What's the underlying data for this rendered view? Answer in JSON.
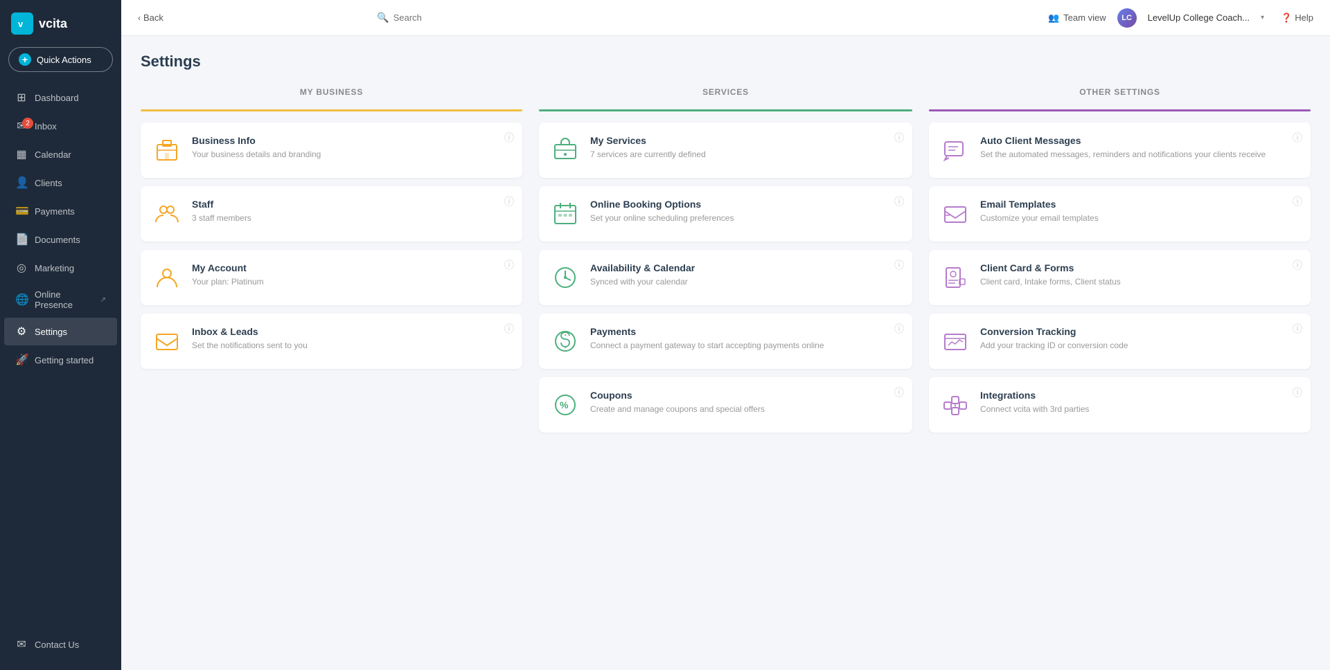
{
  "logo": {
    "text": "vcita",
    "icon": "v"
  },
  "quick_actions": {
    "label": "Quick Actions"
  },
  "nav": {
    "items": [
      {
        "id": "dashboard",
        "label": "Dashboard",
        "icon": "⊞",
        "active": false,
        "badge": null
      },
      {
        "id": "inbox",
        "label": "Inbox",
        "icon": "✉",
        "active": false,
        "badge": "2"
      },
      {
        "id": "calendar",
        "label": "Calendar",
        "icon": "📆",
        "active": false,
        "badge": null
      },
      {
        "id": "clients",
        "label": "Clients",
        "icon": "👤",
        "active": false,
        "badge": null
      },
      {
        "id": "payments",
        "label": "Payments",
        "icon": "💳",
        "active": false,
        "badge": null
      },
      {
        "id": "documents",
        "label": "Documents",
        "icon": "📄",
        "active": false,
        "badge": null
      },
      {
        "id": "marketing",
        "label": "Marketing",
        "icon": "📢",
        "active": false,
        "badge": null
      },
      {
        "id": "online-presence",
        "label": "Online Presence",
        "icon": "🌐",
        "active": false,
        "badge": null,
        "external": true
      },
      {
        "id": "settings",
        "label": "Settings",
        "icon": "⚙",
        "active": true,
        "badge": null
      },
      {
        "id": "getting-started",
        "label": "Getting started",
        "icon": "🚀",
        "active": false,
        "badge": null
      },
      {
        "id": "contact-us",
        "label": "Contact Us",
        "icon": "📞",
        "active": false,
        "badge": null
      }
    ]
  },
  "topbar": {
    "back_label": "Back",
    "search_placeholder": "Search",
    "team_view_label": "Team view",
    "user_name": "LevelUp College Coach...",
    "user_initials": "LC",
    "help_label": "Help"
  },
  "page": {
    "title": "Settings",
    "columns": [
      {
        "id": "my-business",
        "header": "MY BUSINESS",
        "divider_color": "divider-yellow",
        "cards": [
          {
            "id": "business-info",
            "title": "Business Info",
            "subtitle": "Your business details and branding",
            "icon_type": "building",
            "icon_color": "yellow"
          },
          {
            "id": "staff",
            "title": "Staff",
            "subtitle": "3 staff members",
            "icon_type": "users",
            "icon_color": "yellow"
          },
          {
            "id": "my-account",
            "title": "My Account",
            "subtitle": "Your plan: Platinum",
            "icon_type": "account",
            "icon_color": "yellow"
          },
          {
            "id": "inbox-leads",
            "title": "Inbox & Leads",
            "subtitle": "Set the notifications sent to you",
            "icon_type": "inbox",
            "icon_color": "yellow"
          }
        ]
      },
      {
        "id": "services",
        "header": "SERVICES",
        "divider_color": "divider-green",
        "cards": [
          {
            "id": "my-services",
            "title": "My Services",
            "subtitle": "7 services are currently defined",
            "icon_type": "briefcase",
            "icon_color": "green"
          },
          {
            "id": "online-booking",
            "title": "Online Booking Options",
            "subtitle": "Set your online scheduling preferences",
            "icon_type": "calendar",
            "icon_color": "green"
          },
          {
            "id": "availability",
            "title": "Availability & Calendar",
            "subtitle": "Synced with your calendar",
            "icon_type": "clock",
            "icon_color": "green"
          },
          {
            "id": "payments-settings",
            "title": "Payments",
            "subtitle": "Connect a payment gateway to start accepting payments online",
            "icon_type": "payment",
            "icon_color": "green"
          },
          {
            "id": "coupons",
            "title": "Coupons",
            "subtitle": "Create and manage coupons and special offers",
            "icon_type": "coupon",
            "icon_color": "green"
          }
        ]
      },
      {
        "id": "other-settings",
        "header": "OTHER SETTINGS",
        "divider_color": "divider-purple",
        "cards": [
          {
            "id": "auto-client-messages",
            "title": "Auto Client Messages",
            "subtitle": "Set the automated messages, reminders and notifications your clients receive",
            "icon_type": "message",
            "icon_color": "purple"
          },
          {
            "id": "email-templates",
            "title": "Email Templates",
            "subtitle": "Customize your email templates",
            "icon_type": "email",
            "icon_color": "purple"
          },
          {
            "id": "client-card-forms",
            "title": "Client Card & Forms",
            "subtitle": "Client card, Intake forms, Client status",
            "icon_type": "form",
            "icon_color": "purple"
          },
          {
            "id": "conversion-tracking",
            "title": "Conversion Tracking",
            "subtitle": "Add your tracking ID or conversion code",
            "icon_type": "tracking",
            "icon_color": "purple"
          },
          {
            "id": "integrations",
            "title": "Integrations",
            "subtitle": "Connect vcita with 3rd parties",
            "icon_type": "integration",
            "icon_color": "purple"
          }
        ]
      }
    ]
  }
}
